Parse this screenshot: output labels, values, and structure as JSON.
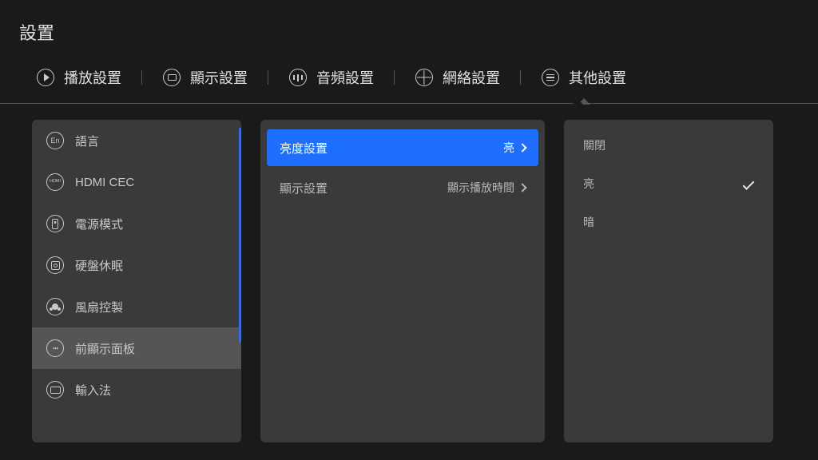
{
  "title": "設置",
  "tabs": [
    {
      "label": "播放設置"
    },
    {
      "label": "顯示設置"
    },
    {
      "label": "音頻設置"
    },
    {
      "label": "網絡設置"
    },
    {
      "label": "其他設置"
    }
  ],
  "sidebar": {
    "items": [
      {
        "label": "語言",
        "icon_text": "En"
      },
      {
        "label": "HDMI CEC",
        "icon_text": "HDMI"
      },
      {
        "label": "電源模式"
      },
      {
        "label": "硬盤休眠"
      },
      {
        "label": "風扇控製"
      },
      {
        "label": "前顯示面板"
      },
      {
        "label": "輸入法"
      }
    ]
  },
  "middle": {
    "rows": [
      {
        "title": "亮度設置",
        "value": "亮"
      },
      {
        "title": "顯示設置",
        "value": "顯示播放時間"
      }
    ]
  },
  "options": [
    {
      "label": "關閉",
      "checked": false
    },
    {
      "label": "亮",
      "checked": true
    },
    {
      "label": "暗",
      "checked": false
    }
  ]
}
